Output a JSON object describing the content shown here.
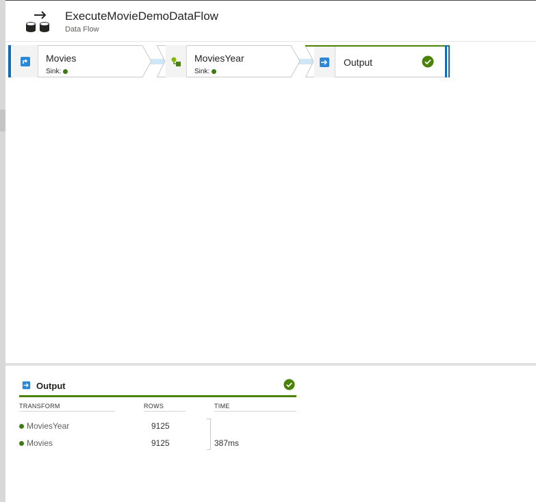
{
  "header": {
    "title": "ExecuteMovieDemoDataFlow",
    "subtitle": "Data Flow",
    "icon": "dataflow-icon"
  },
  "flow": {
    "nodes": [
      {
        "name": "Movies",
        "sink_label": "Sink:",
        "icon": "source-icon",
        "status_color": "#3c7a13"
      },
      {
        "name": "MoviesYear",
        "sink_label": "Sink:",
        "icon": "derived-column-icon",
        "status_color": "#3c7a13"
      },
      {
        "name": "Output",
        "icon": "sink-icon",
        "status": "succeeded"
      }
    ]
  },
  "panel": {
    "title": "Output",
    "title_icon": "sink-icon",
    "status": "succeeded",
    "columns": [
      "TRANSFORM",
      "ROWS",
      "TIME"
    ],
    "rows": [
      {
        "transform": "MoviesYear",
        "rows": "9125",
        "time": ""
      },
      {
        "transform": "Movies",
        "rows": "9125",
        "time": "387ms"
      }
    ]
  },
  "colors": {
    "accent_blue": "#0f6cbd",
    "success_green": "#498205",
    "connector": "#cfe6f7"
  }
}
